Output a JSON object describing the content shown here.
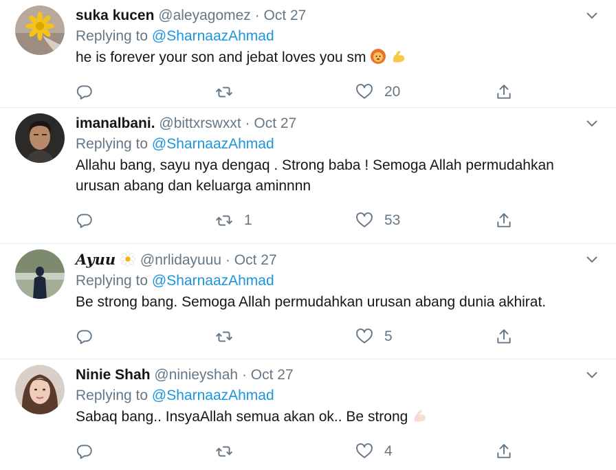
{
  "replying_prefix": "Replying to",
  "colors": {
    "link": "#1b95e0",
    "secondary": "#657786",
    "border": "#e6ecf0"
  },
  "tweets": [
    {
      "name": "suka kucen",
      "handle": "@aleyagomez",
      "dot": "·",
      "time": "Oct 27",
      "reply_to": "@SharnaazAhmad",
      "text": "he is forever your son and jebat loves you sm",
      "emojis": [
        "lion-face-emoji",
        "flexed-biceps-emoji"
      ],
      "retweets": "",
      "likes": "20"
    },
    {
      "name": "imanalbani.",
      "handle": "@bittxrswxxt",
      "dot": "·",
      "time": "Oct 27",
      "reply_to": "@SharnaazAhmad",
      "text": "Allahu bang, sayu nya dengaq . Strong baba ! Semoga Allah permudahkan urusan abang dan keluarga aminnnn",
      "retweets": "1",
      "likes": "53"
    },
    {
      "name": "Ayuu",
      "handle": "@nrlidayuuu",
      "dot": "·",
      "time": "Oct 27",
      "reply_to": "@SharnaazAhmad",
      "text": "Be strong bang. Semoga Allah permudahkan urusan abang dunia akhirat.",
      "name_emoji": "daisy-emoji",
      "retweets": "",
      "likes": "5"
    },
    {
      "name": "Ninie Shah",
      "handle": "@ninieyshah",
      "dot": "·",
      "time": "Oct 27",
      "reply_to": "@SharnaazAhmad",
      "text": "Sabaq bang.. InsyaAllah semua akan ok.. Be strong",
      "emojis": [
        "flexed-biceps-light-emoji"
      ],
      "retweets": "",
      "likes": "4"
    }
  ]
}
